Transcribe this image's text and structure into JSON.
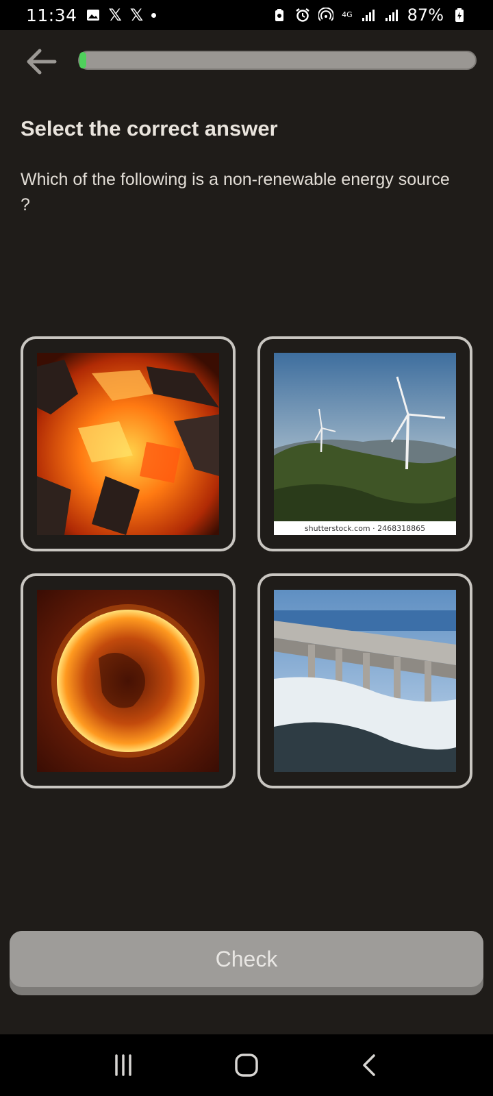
{
  "status_bar": {
    "time": "11:34",
    "x_glyph": "𝕏",
    "battery": "87%",
    "network": "4G"
  },
  "progress": {
    "fraction": 0.012
  },
  "prompt": {
    "title": "Select the correct answer",
    "question": "Which of the following is a non-renewable energy source ?"
  },
  "options": [
    {
      "image": "burning-coal-image"
    },
    {
      "image": "wind-turbines-image",
      "caption": "shutterstock.com · 2468318865"
    },
    {
      "image": "sun-image"
    },
    {
      "image": "hydroelectric-dam-image"
    }
  ],
  "check_button": {
    "label": "Check"
  },
  "colors": {
    "accent": "#4fd05c",
    "background": "#1f1c19",
    "button": "#9e9c99"
  }
}
